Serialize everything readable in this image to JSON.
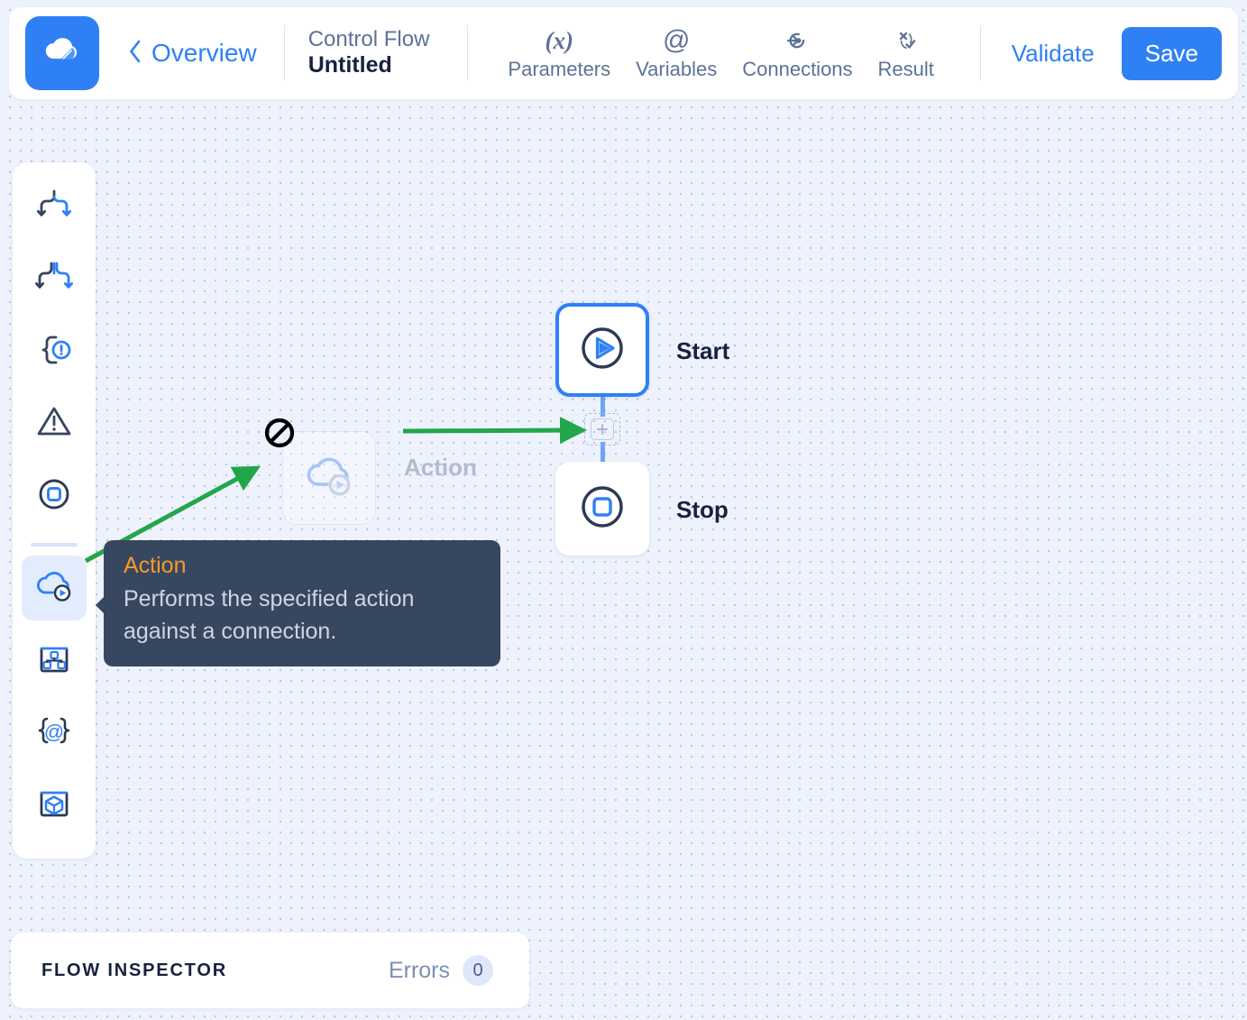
{
  "app": {
    "logo_icon": "cloud-logo-icon"
  },
  "header": {
    "back_label": "Overview",
    "back_icon": "chevron-left-icon",
    "flow_kind": "Control Flow",
    "flow_name": "Untitled",
    "nav": [
      {
        "label": "Parameters",
        "icon": "parameters-x-icon"
      },
      {
        "label": "Variables",
        "icon": "at-sign-icon"
      },
      {
        "label": "Connections",
        "icon": "connection-plug-icon"
      },
      {
        "label": "Result",
        "icon": "result-check-icon"
      }
    ],
    "validate_label": "Validate",
    "save_label": "Save"
  },
  "sidebar": {
    "tools": [
      {
        "name": "condition",
        "icon": "branch-if-icon"
      },
      {
        "name": "switch",
        "icon": "branch-switch-icon"
      },
      {
        "name": "try-catch",
        "icon": "try-catch-icon"
      },
      {
        "name": "throw",
        "icon": "warning-triangle-icon"
      },
      {
        "name": "stop",
        "icon": "stop-circle-icon"
      }
    ],
    "tools_lower": [
      {
        "name": "action",
        "icon": "cloud-action-icon",
        "active": true
      },
      {
        "name": "subflow",
        "icon": "subflow-icon"
      },
      {
        "name": "expression",
        "icon": "expression-braces-icon"
      },
      {
        "name": "component",
        "icon": "component-cube-icon"
      }
    ]
  },
  "canvas": {
    "nodes": [
      {
        "id": "start",
        "label": "Start",
        "icon": "play-circle-icon",
        "selected": true
      },
      {
        "id": "stop",
        "label": "Stop",
        "icon": "stop-square-circle-icon",
        "selected": false
      }
    ],
    "drop_target_icon": "plus-icon",
    "drag_ghost": {
      "label": "Action",
      "icon": "cloud-action-icon",
      "cursor_icon": "no-drop-icon"
    }
  },
  "tooltip": {
    "title": "Action",
    "body": "Performs the specified action against a connection."
  },
  "inspector": {
    "title": "FLOW INSPECTOR",
    "errors_label": "Errors",
    "errors_count": "0"
  },
  "colors": {
    "accent": "#2f80f5",
    "tooltip_bg": "#384760",
    "tooltip_title": "#f59a2a",
    "annotation": "#22a64a",
    "canvas_bg": "#eef2fc",
    "dark_text": "#16223c",
    "muted_text": "#5d7296"
  }
}
